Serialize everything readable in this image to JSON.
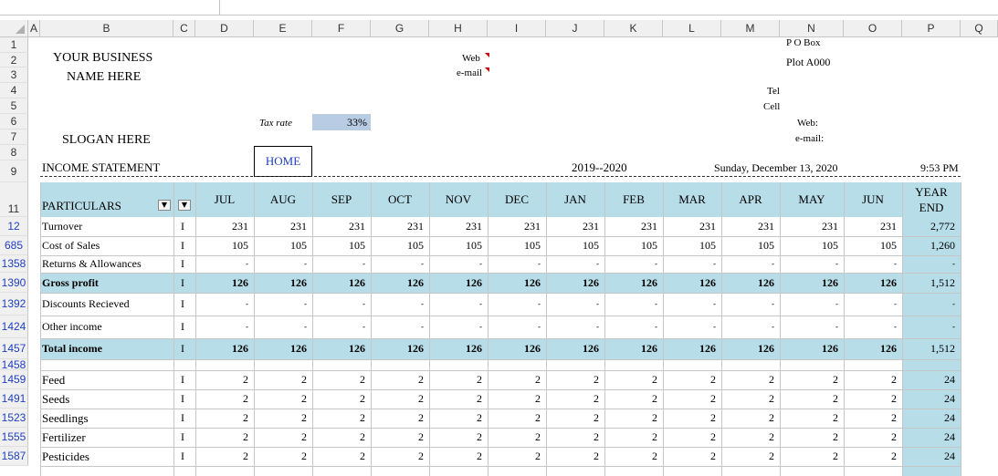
{
  "columns": [
    "A",
    "B",
    "C",
    "D",
    "E",
    "F",
    "G",
    "H",
    "I",
    "J",
    "K",
    "L",
    "M",
    "N",
    "O",
    "P",
    "Q"
  ],
  "business": {
    "name_line1": "YOUR BUSINESS",
    "name_line2": "NAME HERE",
    "slogan": "SLOGAN HERE",
    "web_label": "Web",
    "email_label": "e-mail",
    "po_box": "P O Box",
    "plot": "Plot A000",
    "tel": "Tel",
    "cell": "Cell",
    "web_right": "Web:",
    "email_right": "e-mail:"
  },
  "tax": {
    "label": "Tax rate",
    "value": "33%"
  },
  "statement": {
    "title": "INCOME STATEMENT",
    "home_button": "HOME",
    "period": "2019--2020",
    "date": "Sunday, December 13, 2020",
    "time": "9:53 PM"
  },
  "table": {
    "particulars_header": "PARTICULARS",
    "months": [
      "JUL",
      "AUG",
      "SEP",
      "OCT",
      "NOV",
      "DEC",
      "JAN",
      "FEB",
      "MAR",
      "APR",
      "MAY",
      "JUN"
    ],
    "year_end_line1": "YEAR",
    "year_end_line2": "END",
    "rows": [
      {
        "rownum": "12",
        "label": "Turnover",
        "flag": "I",
        "values": [
          "231",
          "231",
          "231",
          "231",
          "231",
          "231",
          "231",
          "231",
          "231",
          "231",
          "231",
          "231"
        ],
        "total": "2,772"
      },
      {
        "rownum": "685",
        "label": "Cost of Sales",
        "flag": "I",
        "values": [
          "105",
          "105",
          "105",
          "105",
          "105",
          "105",
          "105",
          "105",
          "105",
          "105",
          "105",
          "105"
        ],
        "total": "1,260"
      },
      {
        "rownum": "1358",
        "label": "Returns & Allowances",
        "flag": "I",
        "values": [
          "-",
          "-",
          "-",
          "-",
          "-",
          "-",
          "-",
          "-",
          "-",
          "-",
          "-",
          "-"
        ],
        "total": "-"
      },
      {
        "rownum": "1390",
        "label": "Gross profit",
        "flag": "I",
        "values": [
          "126",
          "126",
          "126",
          "126",
          "126",
          "126",
          "126",
          "126",
          "126",
          "126",
          "126",
          "126"
        ],
        "total": "1,512"
      },
      {
        "rownum": "1392",
        "label": "Discounts Recieved",
        "flag": "I",
        "values": [
          "-",
          "-",
          "-",
          "-",
          "-",
          "-",
          "-",
          "-",
          "-",
          "-",
          "-",
          "-"
        ],
        "total": "-"
      },
      {
        "rownum": "1424",
        "label": "Other income",
        "flag": "I",
        "values": [
          "-",
          "-",
          "-",
          "-",
          "-",
          "-",
          "-",
          "-",
          "-",
          "-",
          "-",
          "-"
        ],
        "total": "-"
      },
      {
        "rownum": "1457",
        "label": "Total income",
        "flag": "I",
        "values": [
          "126",
          "126",
          "126",
          "126",
          "126",
          "126",
          "126",
          "126",
          "126",
          "126",
          "126",
          "126"
        ],
        "total": "1,512"
      },
      {
        "rownum": "1458",
        "label": "",
        "flag": "I",
        "values": [],
        "total": ""
      },
      {
        "rownum": "1459",
        "label": "Feed",
        "flag": "I",
        "values": [
          "2",
          "2",
          "2",
          "2",
          "2",
          "2",
          "2",
          "2",
          "2",
          "2",
          "2",
          "2"
        ],
        "total": "24"
      },
      {
        "rownum": "1491",
        "label": "Seeds",
        "flag": "I",
        "values": [
          "2",
          "2",
          "2",
          "2",
          "2",
          "2",
          "2",
          "2",
          "2",
          "2",
          "2",
          "2"
        ],
        "total": "24"
      },
      {
        "rownum": "1523",
        "label": "Seedlings",
        "flag": "I",
        "values": [
          "2",
          "2",
          "2",
          "2",
          "2",
          "2",
          "2",
          "2",
          "2",
          "2",
          "2",
          "2"
        ],
        "total": "24"
      },
      {
        "rownum": "1555",
        "label": "Fertilizer",
        "flag": "I",
        "values": [
          "2",
          "2",
          "2",
          "2",
          "2",
          "2",
          "2",
          "2",
          "2",
          "2",
          "2",
          "2"
        ],
        "total": "24"
      },
      {
        "rownum": "1587",
        "label": "Pesticides",
        "flag": "I",
        "values": [
          "2",
          "2",
          "2",
          "2",
          "2",
          "2",
          "2",
          "2",
          "2",
          "2",
          "2",
          "2"
        ],
        "total": "24"
      }
    ]
  },
  "top_row_numbers": [
    "1",
    "2",
    "3",
    "4",
    "5",
    "6",
    "7",
    "8",
    "9",
    "11"
  ],
  "colors": {
    "highlight": "#b7dde8",
    "tax_fill": "#b8cce4",
    "link_blue": "#1f3fbf"
  }
}
